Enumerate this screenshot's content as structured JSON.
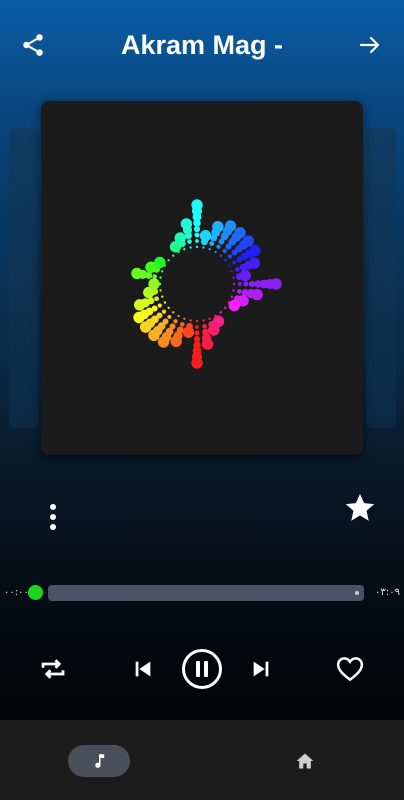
{
  "header": {
    "title": "Akram Mag -",
    "share_icon": "share-icon",
    "forward_icon": "arrow-right-icon"
  },
  "actions": {
    "more_icon": "more-vertical-icon",
    "favorite_star_icon": "star-icon"
  },
  "progress": {
    "elapsed": "۰۰:۰۰",
    "total": "۰۳:۰۹",
    "fraction": 0.0
  },
  "controls": {
    "repeat_icon": "repeat-icon",
    "previous_icon": "skip-previous-icon",
    "play_pause_icon": "pause-icon",
    "next_icon": "skip-next-icon",
    "like_icon": "heart-outline-icon"
  },
  "bottom_nav": {
    "items": [
      {
        "icon": "music-note-icon",
        "active": true
      },
      {
        "icon": "home-icon",
        "active": false
      }
    ]
  },
  "colors": {
    "accent": "#1ed51e",
    "track": "#4c5264",
    "nav_bg": "#1c1c1c",
    "nav_active": "#4a4f5b"
  }
}
